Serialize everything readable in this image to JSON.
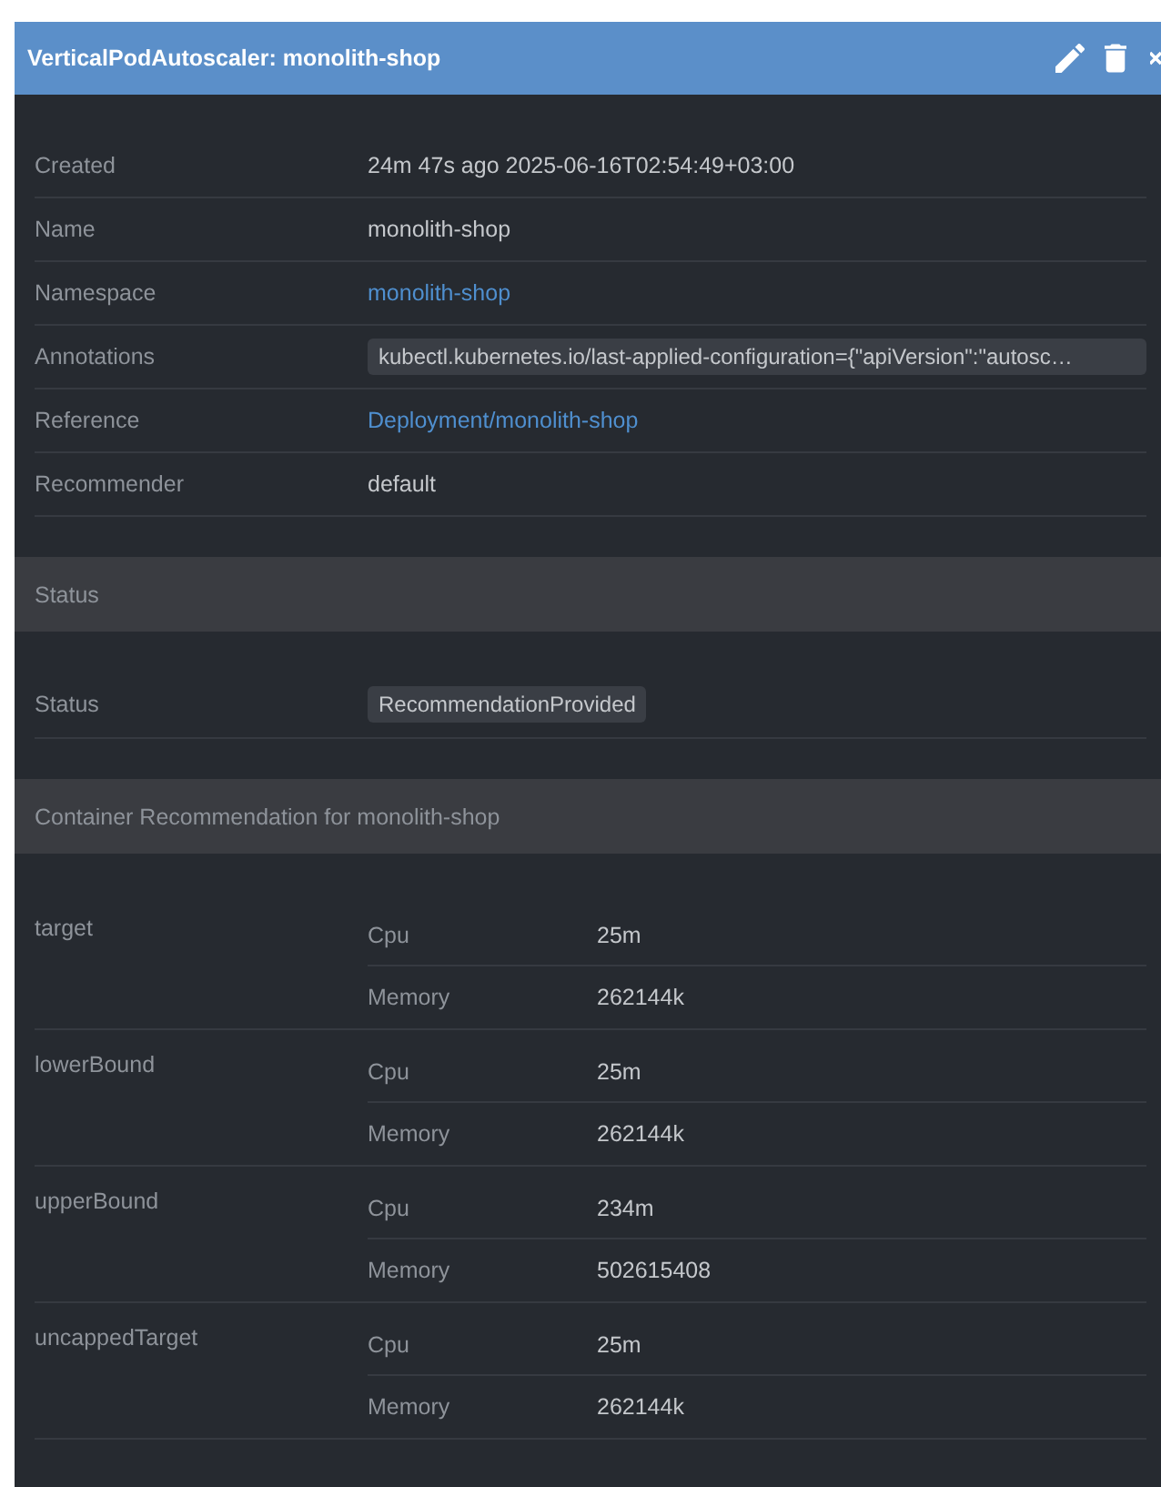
{
  "window": {
    "title": "VerticalPodAutoscaler: monolith-shop"
  },
  "toolbar": {
    "actions": [
      {
        "kind": "edit"
      },
      {
        "kind": "delete"
      },
      {
        "kind": "close"
      }
    ]
  },
  "details": [
    {
      "label": "Created",
      "kind": "text",
      "value": "24m 47s ago 2025-06-16T02:54:49+03:00"
    },
    {
      "label": "Name",
      "kind": "text",
      "value": "monolith-shop"
    },
    {
      "label": "Namespace",
      "kind": "link",
      "value": "monolith-shop"
    },
    {
      "label": "Annotations",
      "kind": "badge",
      "value": "kubectl.kubernetes.io/last-applied-configuration={\"apiVersion\":\"autosc…"
    },
    {
      "label": "Reference",
      "kind": "link",
      "value": "Deployment/monolith-shop"
    },
    {
      "label": "Recommender",
      "kind": "text",
      "value": "default"
    }
  ],
  "status_section": {
    "title": "Status",
    "rows": [
      {
        "label": "Status",
        "kind": "badge",
        "value": "RecommendationProvided"
      }
    ]
  },
  "container_section": {
    "title": "Container Recommendation for monolith-shop",
    "groups": [
      {
        "name": "target",
        "resources": [
          {
            "name": "Cpu",
            "value": "25m"
          },
          {
            "name": "Memory",
            "value": "262144k"
          }
        ]
      },
      {
        "name": "lowerBound",
        "resources": [
          {
            "name": "Cpu",
            "value": "25m"
          },
          {
            "name": "Memory",
            "value": "262144k"
          }
        ]
      },
      {
        "name": "upperBound",
        "resources": [
          {
            "name": "Cpu",
            "value": "234m"
          },
          {
            "name": "Memory",
            "value": "502615408"
          }
        ]
      },
      {
        "name": "uncappedTarget",
        "resources": [
          {
            "name": "Cpu",
            "value": "25m"
          },
          {
            "name": "Memory",
            "value": "262144k"
          }
        ]
      }
    ]
  }
}
